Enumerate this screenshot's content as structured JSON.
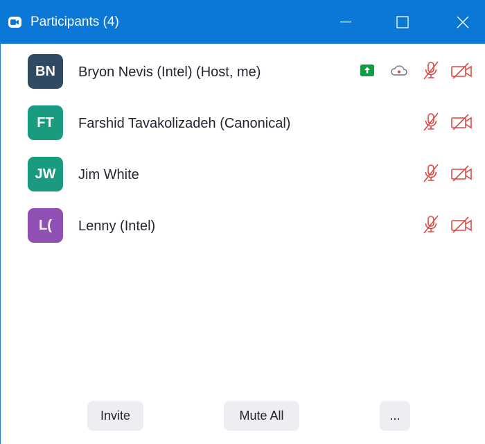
{
  "window": {
    "title": "Participants (4)",
    "accent": "#0b78d7"
  },
  "participants": [
    {
      "initials": "BN",
      "name": "Bryon Nevis (Intel) (Host, me)",
      "avatar_color": "#2f4a62",
      "sharing": true,
      "recording": true,
      "muted": true,
      "video_off": true
    },
    {
      "initials": "FT",
      "name": "Farshid Tavakolizadeh (Canonical)",
      "avatar_color": "#1a9a7e",
      "sharing": false,
      "recording": false,
      "muted": true,
      "video_off": true
    },
    {
      "initials": "JW",
      "name": "Jim White",
      "avatar_color": "#1a9a7e",
      "sharing": false,
      "recording": false,
      "muted": true,
      "video_off": true
    },
    {
      "initials": "L(",
      "name": "Lenny (Intel)",
      "avatar_color": "#9150b3",
      "sharing": false,
      "recording": false,
      "muted": true,
      "video_off": true
    }
  ],
  "footer": {
    "invite_label": "Invite",
    "mute_all_label": "Mute All",
    "more_label": "..."
  },
  "colors": {
    "muted_icon": "#e0463f",
    "share_badge": "#0e9e43",
    "cloud_icon": "#6e6e7e"
  }
}
